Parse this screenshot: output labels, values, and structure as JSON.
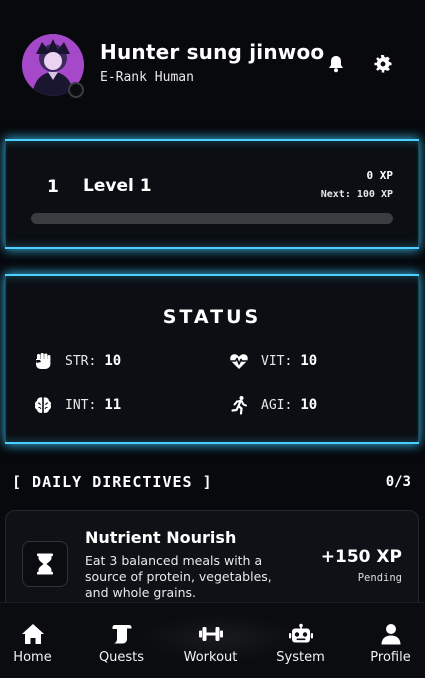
{
  "header": {
    "username": "Hunter sung jinwoo",
    "rank": "E-Rank Human",
    "icons": [
      "bell-icon",
      "gear-icon"
    ]
  },
  "level": {
    "number": "1",
    "title": "Level 1",
    "xp_current": "0 XP",
    "xp_next": "Next: 100 XP",
    "progress_fraction": 0.0
  },
  "status": {
    "title": "STATUS",
    "stats": {
      "str": {
        "label": "STR:",
        "value": "10",
        "icon": "fist-icon"
      },
      "vit": {
        "label": "VIT:",
        "value": "10",
        "icon": "heartbeat-icon"
      },
      "int": {
        "label": "INT:",
        "value": "11",
        "icon": "brain-icon"
      },
      "agi": {
        "label": "AGI:",
        "value": "10",
        "icon": "running-icon"
      }
    }
  },
  "directives": {
    "title": "[ DAILY DIRECTIVES ]",
    "count": "0/3",
    "quests": [
      {
        "title": "Nutrient Nourish",
        "description": "Eat 3 balanced meals with a source of protein, vegetables, and whole grains.",
        "xp": "+150 XP",
        "state": "Pending",
        "icon": "hourglass-icon"
      }
    ]
  },
  "nav": {
    "items": [
      {
        "label": "Home",
        "icon": "home-icon"
      },
      {
        "label": "Quests",
        "icon": "scroll-icon"
      },
      {
        "label": "Workout",
        "icon": "dumbbell-icon"
      },
      {
        "label": "System",
        "icon": "robot-icon"
      },
      {
        "label": "Profile",
        "icon": "user-icon"
      }
    ]
  },
  "colors": {
    "accent": "#4cd0ff",
    "background": "#07090c",
    "card": "#0b0e12",
    "avatar_ring": "#b04bcf"
  }
}
